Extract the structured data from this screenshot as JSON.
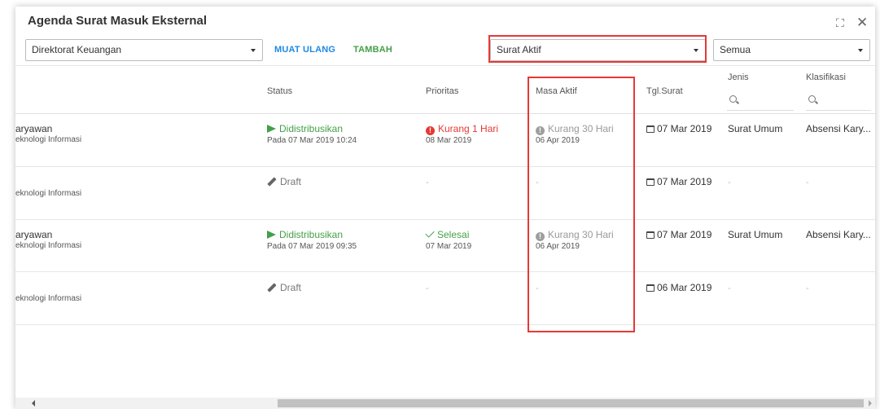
{
  "window": {
    "title": "Agenda Surat Masuk Eksternal"
  },
  "toolbar": {
    "direktorat_value": "Direktorat Keuangan",
    "reload_label": "MUAT ULANG",
    "add_label": "TAMBAH",
    "status_filter_value": "Surat Aktif",
    "type_filter_value": "Semua"
  },
  "columns": {
    "status": "Status",
    "prioritas": "Prioritas",
    "masa_aktif": "Masa Aktif",
    "tgl_surat": "Tgl.Surat",
    "jenis": "Jenis",
    "klasifikasi": "Klasifikasi"
  },
  "rows": [
    {
      "name": "aryawan",
      "unit": "eknologi Informasi",
      "status": "Didistribusikan",
      "status_sub": "Pada 07 Mar 2019 10:24",
      "prioritas": "Kurang 1 Hari",
      "prioritas_sub": "08 Mar 2019",
      "masa_aktif": "Kurang 30 Hari",
      "masa_aktif_sub": "06 Apr 2019",
      "tgl_surat": "07 Mar 2019",
      "jenis": "Surat Umum",
      "klasifikasi": "Absensi Kary..."
    },
    {
      "name": "",
      "unit": "eknologi Informasi",
      "status": "Draft",
      "prioritas": "-",
      "masa_aktif": "-",
      "tgl_surat": "07 Mar 2019",
      "jenis": "-",
      "klasifikasi": "-"
    },
    {
      "name": "aryawan",
      "unit": "eknologi Informasi",
      "status": "Didistribusikan",
      "status_sub": "Pada 07 Mar 2019 09:35",
      "prioritas": "Selesai",
      "prioritas_sub": "07 Mar 2019",
      "masa_aktif": "Kurang 30 Hari",
      "masa_aktif_sub": "06 Apr 2019",
      "tgl_surat": "07 Mar 2019",
      "jenis": "Surat Umum",
      "klasifikasi": "Absensi Kary..."
    },
    {
      "name": "",
      "unit": "eknologi Informasi",
      "status": "Draft",
      "prioritas": "-",
      "masa_aktif": "-",
      "tgl_surat": "06 Mar 2019",
      "jenis": "-",
      "klasifikasi": "-"
    }
  ]
}
